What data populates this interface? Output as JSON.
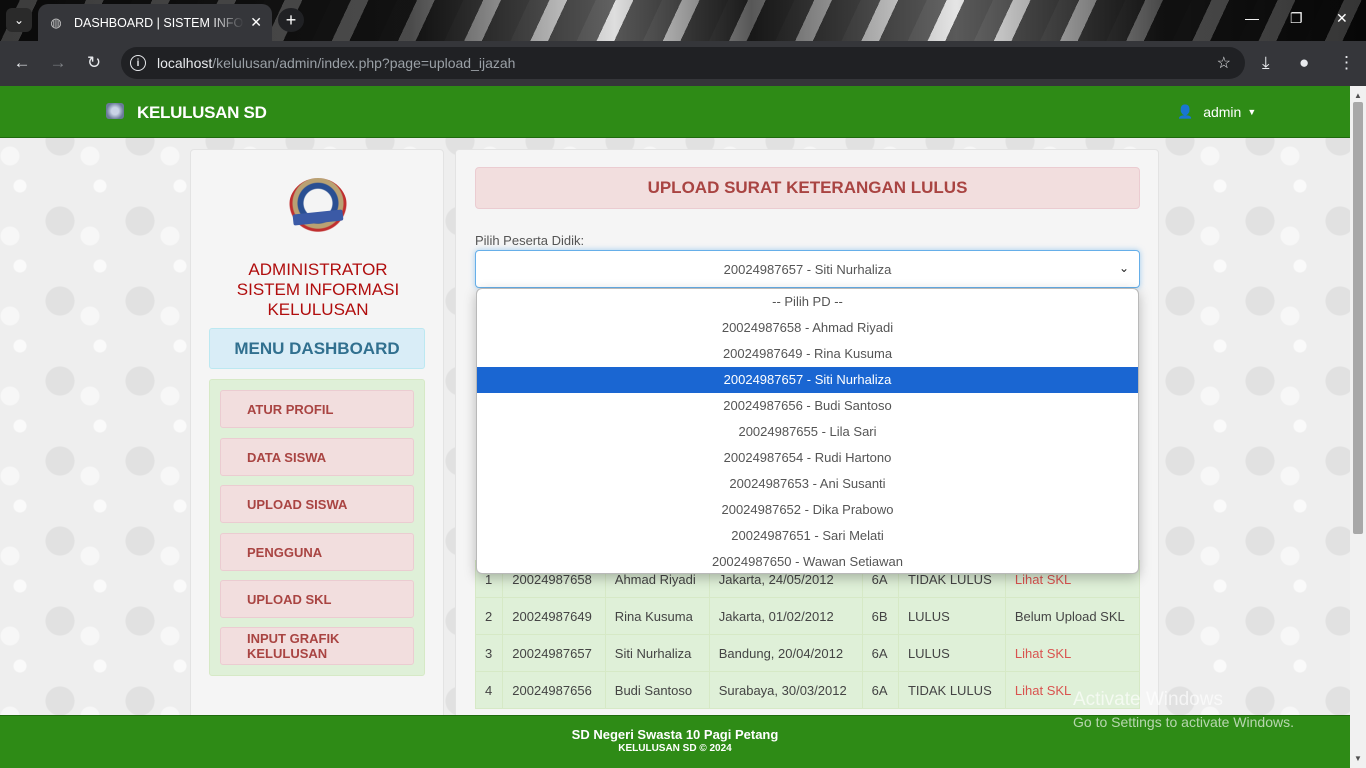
{
  "browser": {
    "tab_title": "DASHBOARD | SISTEM INFORMASI KELULUSAN",
    "url_host": "localhost",
    "url_path": "/kelulusan/admin/index.php?page=upload_ijazah",
    "new_tab_symbol": "+",
    "tab_close_symbol": "✕"
  },
  "navbar": {
    "brand": "KELULUSAN SD",
    "user": "admin"
  },
  "sidebar": {
    "title_line1": "ADMINISTRATOR",
    "title_line2": "SISTEM INFORMASI KELULUSAN",
    "menu_header": "MENU DASHBOARD",
    "items": [
      {
        "label": "ATUR PROFIL"
      },
      {
        "label": "DATA SISWA"
      },
      {
        "label": "UPLOAD SISWA"
      },
      {
        "label": "PENGGUNA"
      },
      {
        "label": "UPLOAD SKL"
      },
      {
        "label": "INPUT GRAFIK KELULUSAN"
      }
    ]
  },
  "main": {
    "title": "UPLOAD SURAT KETERANGAN LULUS",
    "select_label": "Pilih Peserta Didik:",
    "select_value": "20024987657 - Siti Nurhaliza",
    "options": [
      {
        "label": "-- Pilih PD --",
        "selected": false
      },
      {
        "label": "20024987658 - Ahmad Riyadi",
        "selected": false
      },
      {
        "label": "20024987649 - Rina Kusuma",
        "selected": false
      },
      {
        "label": "20024987657 - Siti Nurhaliza",
        "selected": true
      },
      {
        "label": "20024987656 - Budi Santoso",
        "selected": false
      },
      {
        "label": "20024987655 - Lila Sari",
        "selected": false
      },
      {
        "label": "20024987654 - Rudi Hartono",
        "selected": false
      },
      {
        "label": "20024987653 - Ani Susanti",
        "selected": false
      },
      {
        "label": "20024987652 - Dika Prabowo",
        "selected": false
      },
      {
        "label": "20024987651 - Sari Melati",
        "selected": false
      },
      {
        "label": "20024987650 - Wawan Setiawan",
        "selected": false
      }
    ],
    "table_rows": [
      {
        "no": "1",
        "nisn": "20024987658",
        "nama": "Ahmad Riyadi",
        "ttl": "Jakarta, 24/05/2012",
        "kelas": "6A",
        "status": "TIDAK LULUS",
        "skl": "Lihat SKL",
        "skl_link": true
      },
      {
        "no": "2",
        "nisn": "20024987649",
        "nama": "Rina Kusuma",
        "ttl": "Jakarta, 01/02/2012",
        "kelas": "6B",
        "status": "LULUS",
        "skl": "Belum Upload SKL",
        "skl_link": false
      },
      {
        "no": "3",
        "nisn": "20024987657",
        "nama": "Siti Nurhaliza",
        "ttl": "Bandung, 20/04/2012",
        "kelas": "6A",
        "status": "LULUS",
        "skl": "Lihat SKL",
        "skl_link": true
      },
      {
        "no": "4",
        "nisn": "20024987656",
        "nama": "Budi Santoso",
        "ttl": "Surabaya, 30/03/2012",
        "kelas": "6A",
        "status": "TIDAK LULUS",
        "skl": "Lihat SKL",
        "skl_link": true
      }
    ]
  },
  "footer": {
    "line1": "SD Negeri Swasta 10 Pagi Petang",
    "line2": "KELULUSAN SD © 2024"
  },
  "watermark": {
    "line1": "Activate Windows",
    "line2": "Go to Settings to activate Windows."
  },
  "colors": {
    "navbar_green": "#2e8b16",
    "danger_text": "#a94442",
    "selected_option": "#1a66d2",
    "info_header": "#d9edf7",
    "success_panel": "#dff0d8"
  }
}
